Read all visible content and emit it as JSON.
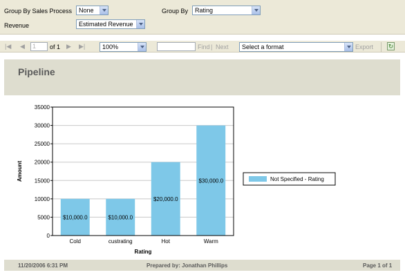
{
  "params": {
    "group_by_sales_process_label": "Group By Sales Process",
    "group_by_sales_process_value": "None",
    "group_by_label": "Group By",
    "group_by_value": "Rating",
    "revenue_label": "Revenue",
    "revenue_value": "Estimated Revenue"
  },
  "toolbar": {
    "first_glyph": "|◀",
    "prev_glyph": "◀",
    "page_value": "1",
    "of_text": "of 1",
    "next_glyph": "▶",
    "last_glyph": "▶|",
    "zoom_value": "100%",
    "find_label": "Find",
    "find_separator": "|",
    "next_label": "Next",
    "format_placeholder": "Select a format",
    "export_label": "Export"
  },
  "report": {
    "title": "Pipeline"
  },
  "chart_data": {
    "type": "bar",
    "categories": [
      "Cold",
      "custrating",
      "Hot",
      "Warm"
    ],
    "series": [
      {
        "name": "Not Specified - Rating",
        "values": [
          10000,
          10000,
          20000,
          30000
        ],
        "data_labels": [
          "$10,000.0",
          "$10,000.0",
          "$20,000.0",
          "$30,000.0"
        ]
      }
    ],
    "xlabel": "Rating",
    "ylabel": "Amount",
    "ylim": [
      0,
      35000
    ],
    "yticks": [
      0,
      5000,
      10000,
      15000,
      20000,
      25000,
      30000,
      35000
    ],
    "grid": true,
    "legend_position": "right",
    "bar_color": "#7ec8e8"
  },
  "footer": {
    "date": "11/20/2006 6:31 PM",
    "prepared_by": "Prepared by: Jonathan Phillips",
    "page": "Page 1 of 1"
  },
  "icons": {
    "refresh": "refresh-icon"
  }
}
